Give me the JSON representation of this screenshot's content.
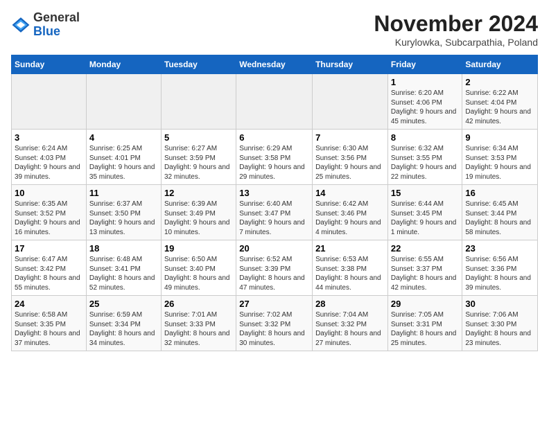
{
  "header": {
    "logo_general": "General",
    "logo_blue": "Blue",
    "month_title": "November 2024",
    "location": "Kurylowka, Subcarpathia, Poland"
  },
  "weekdays": [
    "Sunday",
    "Monday",
    "Tuesday",
    "Wednesday",
    "Thursday",
    "Friday",
    "Saturday"
  ],
  "weeks": [
    [
      {
        "day": "",
        "sunrise": "",
        "sunset": "",
        "daylight": ""
      },
      {
        "day": "",
        "sunrise": "",
        "sunset": "",
        "daylight": ""
      },
      {
        "day": "",
        "sunrise": "",
        "sunset": "",
        "daylight": ""
      },
      {
        "day": "",
        "sunrise": "",
        "sunset": "",
        "daylight": ""
      },
      {
        "day": "",
        "sunrise": "",
        "sunset": "",
        "daylight": ""
      },
      {
        "day": "1",
        "sunrise": "Sunrise: 6:20 AM",
        "sunset": "Sunset: 4:06 PM",
        "daylight": "Daylight: 9 hours and 45 minutes."
      },
      {
        "day": "2",
        "sunrise": "Sunrise: 6:22 AM",
        "sunset": "Sunset: 4:04 PM",
        "daylight": "Daylight: 9 hours and 42 minutes."
      }
    ],
    [
      {
        "day": "3",
        "sunrise": "Sunrise: 6:24 AM",
        "sunset": "Sunset: 4:03 PM",
        "daylight": "Daylight: 9 hours and 39 minutes."
      },
      {
        "day": "4",
        "sunrise": "Sunrise: 6:25 AM",
        "sunset": "Sunset: 4:01 PM",
        "daylight": "Daylight: 9 hours and 35 minutes."
      },
      {
        "day": "5",
        "sunrise": "Sunrise: 6:27 AM",
        "sunset": "Sunset: 3:59 PM",
        "daylight": "Daylight: 9 hours and 32 minutes."
      },
      {
        "day": "6",
        "sunrise": "Sunrise: 6:29 AM",
        "sunset": "Sunset: 3:58 PM",
        "daylight": "Daylight: 9 hours and 29 minutes."
      },
      {
        "day": "7",
        "sunrise": "Sunrise: 6:30 AM",
        "sunset": "Sunset: 3:56 PM",
        "daylight": "Daylight: 9 hours and 25 minutes."
      },
      {
        "day": "8",
        "sunrise": "Sunrise: 6:32 AM",
        "sunset": "Sunset: 3:55 PM",
        "daylight": "Daylight: 9 hours and 22 minutes."
      },
      {
        "day": "9",
        "sunrise": "Sunrise: 6:34 AM",
        "sunset": "Sunset: 3:53 PM",
        "daylight": "Daylight: 9 hours and 19 minutes."
      }
    ],
    [
      {
        "day": "10",
        "sunrise": "Sunrise: 6:35 AM",
        "sunset": "Sunset: 3:52 PM",
        "daylight": "Daylight: 9 hours and 16 minutes."
      },
      {
        "day": "11",
        "sunrise": "Sunrise: 6:37 AM",
        "sunset": "Sunset: 3:50 PM",
        "daylight": "Daylight: 9 hours and 13 minutes."
      },
      {
        "day": "12",
        "sunrise": "Sunrise: 6:39 AM",
        "sunset": "Sunset: 3:49 PM",
        "daylight": "Daylight: 9 hours and 10 minutes."
      },
      {
        "day": "13",
        "sunrise": "Sunrise: 6:40 AM",
        "sunset": "Sunset: 3:47 PM",
        "daylight": "Daylight: 9 hours and 7 minutes."
      },
      {
        "day": "14",
        "sunrise": "Sunrise: 6:42 AM",
        "sunset": "Sunset: 3:46 PM",
        "daylight": "Daylight: 9 hours and 4 minutes."
      },
      {
        "day": "15",
        "sunrise": "Sunrise: 6:44 AM",
        "sunset": "Sunset: 3:45 PM",
        "daylight": "Daylight: 9 hours and 1 minute."
      },
      {
        "day": "16",
        "sunrise": "Sunrise: 6:45 AM",
        "sunset": "Sunset: 3:44 PM",
        "daylight": "Daylight: 8 hours and 58 minutes."
      }
    ],
    [
      {
        "day": "17",
        "sunrise": "Sunrise: 6:47 AM",
        "sunset": "Sunset: 3:42 PM",
        "daylight": "Daylight: 8 hours and 55 minutes."
      },
      {
        "day": "18",
        "sunrise": "Sunrise: 6:48 AM",
        "sunset": "Sunset: 3:41 PM",
        "daylight": "Daylight: 8 hours and 52 minutes."
      },
      {
        "day": "19",
        "sunrise": "Sunrise: 6:50 AM",
        "sunset": "Sunset: 3:40 PM",
        "daylight": "Daylight: 8 hours and 49 minutes."
      },
      {
        "day": "20",
        "sunrise": "Sunrise: 6:52 AM",
        "sunset": "Sunset: 3:39 PM",
        "daylight": "Daylight: 8 hours and 47 minutes."
      },
      {
        "day": "21",
        "sunrise": "Sunrise: 6:53 AM",
        "sunset": "Sunset: 3:38 PM",
        "daylight": "Daylight: 8 hours and 44 minutes."
      },
      {
        "day": "22",
        "sunrise": "Sunrise: 6:55 AM",
        "sunset": "Sunset: 3:37 PM",
        "daylight": "Daylight: 8 hours and 42 minutes."
      },
      {
        "day": "23",
        "sunrise": "Sunrise: 6:56 AM",
        "sunset": "Sunset: 3:36 PM",
        "daylight": "Daylight: 8 hours and 39 minutes."
      }
    ],
    [
      {
        "day": "24",
        "sunrise": "Sunrise: 6:58 AM",
        "sunset": "Sunset: 3:35 PM",
        "daylight": "Daylight: 8 hours and 37 minutes."
      },
      {
        "day": "25",
        "sunrise": "Sunrise: 6:59 AM",
        "sunset": "Sunset: 3:34 PM",
        "daylight": "Daylight: 8 hours and 34 minutes."
      },
      {
        "day": "26",
        "sunrise": "Sunrise: 7:01 AM",
        "sunset": "Sunset: 3:33 PM",
        "daylight": "Daylight: 8 hours and 32 minutes."
      },
      {
        "day": "27",
        "sunrise": "Sunrise: 7:02 AM",
        "sunset": "Sunset: 3:32 PM",
        "daylight": "Daylight: 8 hours and 30 minutes."
      },
      {
        "day": "28",
        "sunrise": "Sunrise: 7:04 AM",
        "sunset": "Sunset: 3:32 PM",
        "daylight": "Daylight: 8 hours and 27 minutes."
      },
      {
        "day": "29",
        "sunrise": "Sunrise: 7:05 AM",
        "sunset": "Sunset: 3:31 PM",
        "daylight": "Daylight: 8 hours and 25 minutes."
      },
      {
        "day": "30",
        "sunrise": "Sunrise: 7:06 AM",
        "sunset": "Sunset: 3:30 PM",
        "daylight": "Daylight: 8 hours and 23 minutes."
      }
    ]
  ]
}
